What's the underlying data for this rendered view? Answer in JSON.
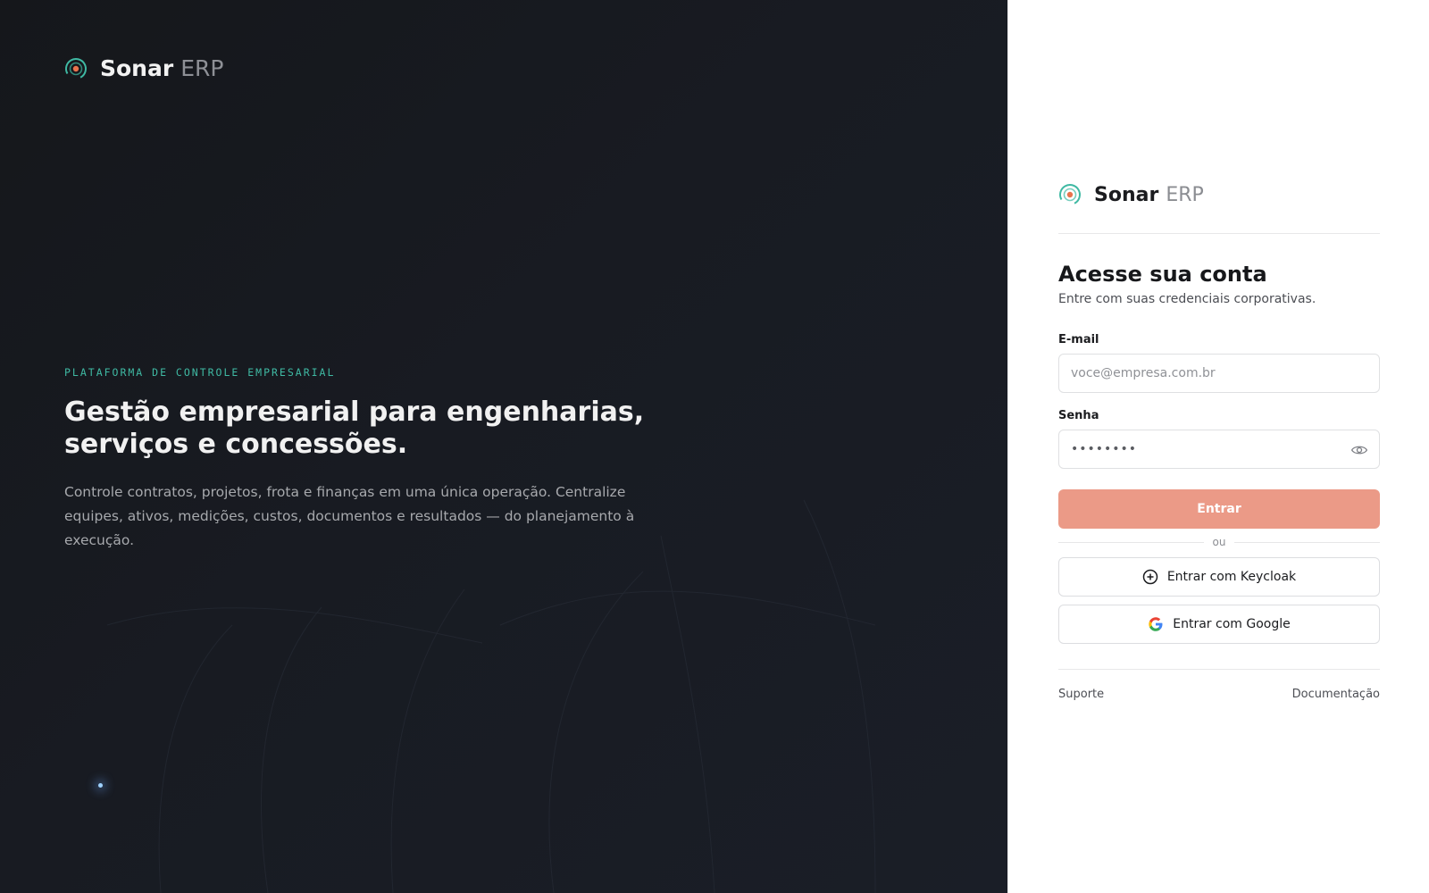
{
  "brand": {
    "name": "Sonar",
    "suffix": "ERP"
  },
  "hero": {
    "eyebrow": "PLATAFORMA DE CONTROLE EMPRESARIAL",
    "title_line1": "Gestão empresarial para engenharias,",
    "title_line2": "serviços e concessões.",
    "description": "Controle contratos, projetos, frota e finanças em uma única operação. Centralize equipes, ativos, medições, custos, documentos e resultados — do planejamento à execução."
  },
  "login": {
    "title": "Acesse sua conta",
    "subtitle": "Entre com suas credenciais corporativas.",
    "email_label": "E-mail",
    "email_placeholder": "voce@empresa.com.br",
    "email_value": "",
    "password_label": "Senha",
    "password_value": "••••••••",
    "submit_label": "Entrar",
    "divider_text": "ou",
    "keycloak_label": "Entrar com Keycloak",
    "google_label": "Entrar com Google",
    "support_link": "Suporte",
    "docs_link": "Documentação"
  },
  "colors": {
    "accent": "#eb9a87",
    "eyebrow": "#3fb9a3",
    "hero_bg": "#181b22"
  },
  "icons": {
    "logo": "sonar-logo-icon",
    "eye": "eye-icon",
    "keycloak": "plus-circle-icon",
    "google": "google-icon"
  }
}
